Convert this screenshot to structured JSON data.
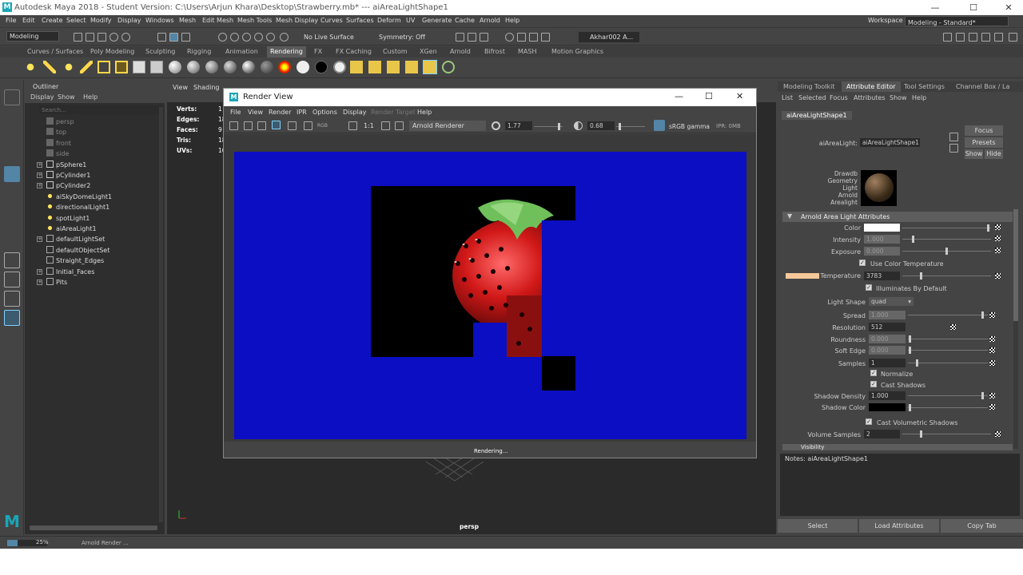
{
  "window": {
    "title": "Autodesk Maya 2018 - Student Version: C:\\Users\\Arjun Khara\\Desktop\\Strawberry.mb*   ---   aiAreaLightShape1",
    "minimize": "—",
    "maximize": "☐",
    "close": "✕"
  },
  "menubar": [
    "File",
    "Edit",
    "Create",
    "Select",
    "Modify",
    "Display",
    "Windows",
    "Mesh",
    "Edit Mesh",
    "Mesh Tools",
    "Mesh Display",
    "Curves",
    "Surfaces",
    "Deform",
    "UV",
    "Generate",
    "Cache",
    "Arnold",
    "Help"
  ],
  "workspace": {
    "label": "Workspace :",
    "value": "Modeling - Standard*"
  },
  "statusline": {
    "mode": "Modeling",
    "live_surface": "No Live Surface",
    "symmetry": "Symmetry: Off",
    "user": "Akhar002 A..."
  },
  "shelf_tabs": [
    "Curves / Surfaces",
    "Poly Modeling",
    "Sculpting",
    "Rigging",
    "Animation",
    "Rendering",
    "FX",
    "FX Caching",
    "Custom",
    "XGen",
    "Arnold",
    "Bifrost",
    "MASH",
    "Motion Graphics"
  ],
  "shelf_active": "Rendering",
  "outliner": {
    "title": "Outliner",
    "menu": [
      "Display",
      "Show",
      "Help"
    ],
    "search_placeholder": "Search...",
    "items": [
      {
        "label": "persp",
        "dim": true,
        "expand": false
      },
      {
        "label": "top",
        "dim": true,
        "expand": false
      },
      {
        "label": "front",
        "dim": true,
        "expand": false
      },
      {
        "label": "side",
        "dim": true,
        "expand": false
      },
      {
        "label": "pSphere1",
        "dim": false,
        "expand": true
      },
      {
        "label": "pCylinder1",
        "dim": false,
        "expand": true
      },
      {
        "label": "pCylinder2",
        "dim": false,
        "expand": true
      },
      {
        "label": "aiSkyDomeLight1",
        "dim": false,
        "expand": false
      },
      {
        "label": "directionalLight1",
        "dim": false,
        "expand": false
      },
      {
        "label": "spotLight1",
        "dim": false,
        "expand": false
      },
      {
        "label": "aiAreaLight1",
        "dim": false,
        "expand": false
      },
      {
        "label": "defaultLightSet",
        "dim": false,
        "expand": true
      },
      {
        "label": "defaultObjectSet",
        "dim": false,
        "expand": false
      },
      {
        "label": "Straight_Edges",
        "dim": false,
        "expand": false
      },
      {
        "label": "Initial_Faces",
        "dim": false,
        "expand": true
      },
      {
        "label": "Pits",
        "dim": false,
        "expand": true
      }
    ]
  },
  "viewport": {
    "menu": [
      "View",
      "Shading"
    ],
    "hud": [
      {
        "label": "Verts:",
        "value": "1"
      },
      {
        "label": "Edges:",
        "value": "18"
      },
      {
        "label": "Faces:",
        "value": "9"
      },
      {
        "label": "Tris:",
        "value": "18"
      },
      {
        "label": "UVs:",
        "value": "10"
      }
    ],
    "camera": "persp"
  },
  "render_view": {
    "title": "Render View",
    "menu": [
      "File",
      "View",
      "Render",
      "IPR",
      "Options",
      "Display",
      "Render Target",
      "Help"
    ],
    "renderer": "Arnold Renderer",
    "ratio": "1:1",
    "exposure": "1.77",
    "gamma": "0.68",
    "color_space": "sRGB gamma",
    "ipr": "IPR: 0MB",
    "status": "Rendering...",
    "background_color": "#0b0ec2"
  },
  "attr_tabs": [
    "Modeling Toolkit",
    "Attribute Editor",
    "Tool Settings",
    "Channel Box / La"
  ],
  "attr_tab_active": "Attribute Editor",
  "attr_menu": [
    "List",
    "Selected",
    "Focus",
    "Attributes",
    "Show",
    "Help"
  ],
  "attr": {
    "node_tab": "aiAreaLightShape1",
    "node_label": "aiAreaLight:",
    "node_value": "aiAreaLightShape1",
    "focus": "Focus",
    "presets": "Presets",
    "show": "Show",
    "hide": "Hide",
    "swatch_label": "Drawdb Geometry Light Arnold Arealight",
    "section": "Arnold Area Light Attributes",
    "color_label": "Color",
    "intensity_label": "Intensity",
    "intensity": "1.000",
    "exposure_label": "Exposure",
    "exposure": "0.000",
    "use_color_temp": "Use Color Temperature",
    "temperature_label": "Temperature",
    "temperature": "3783",
    "illuminates": "Illuminates By Default",
    "light_shape_label": "Light Shape",
    "light_shape": "quad",
    "spread_label": "Spread",
    "spread": "1.000",
    "resolution_label": "Resolution",
    "resolution": "512",
    "roundness_label": "Roundness",
    "roundness": "0.000",
    "soft_edge_label": "Soft Edge",
    "soft_edge": "0.000",
    "samples_label": "Samples",
    "samples": "1",
    "normalize": "Normalize",
    "cast_shadows": "Cast Shadows",
    "shadow_density_label": "Shadow Density",
    "shadow_density": "1.000",
    "shadow_color_label": "Shadow Color",
    "cast_vol_shadows": "Cast Volumetric Shadows",
    "volume_samples_label": "Volume Samples",
    "volume_samples": "2",
    "visibility": "Visibility",
    "notes": "Notes:  aiAreaLightShape1",
    "btn_select": "Select",
    "btn_load": "Load Attributes",
    "btn_copy": "Copy Tab",
    "temp_swatch_color": "#f7c89a"
  },
  "helpline": {
    "progress": "25%",
    "progress_fraction": 0.25,
    "message": "Arnold Render ..."
  }
}
